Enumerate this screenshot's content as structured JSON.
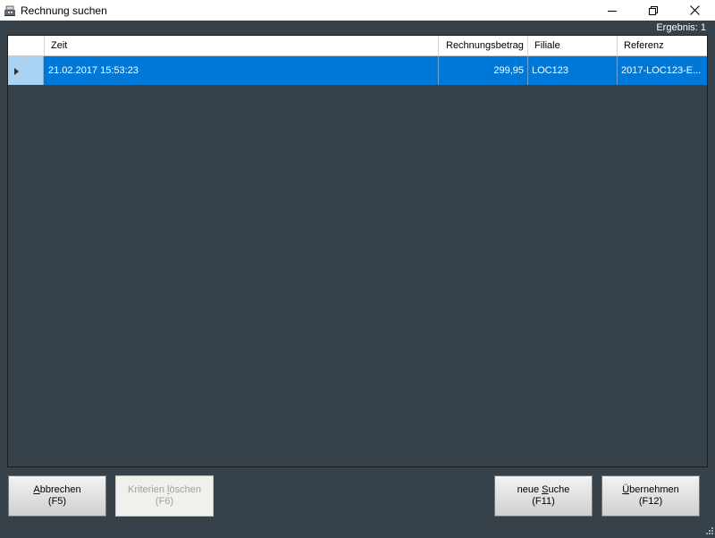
{
  "window": {
    "title": "Rechnung suchen",
    "icon": "cash-register-icon",
    "controls": [
      "minimize-icon",
      "restore-icon",
      "close-icon"
    ]
  },
  "result": {
    "label": "Ergebnis: 1"
  },
  "grid": {
    "columns": [
      "Zeit",
      "Rechnungsbetrag",
      "Filiale",
      "Referenz"
    ],
    "rows": [
      {
        "zeit": "21.02.2017 15:53:23",
        "betrag": "299,95",
        "filiale": "LOC123",
        "referenz": "2017-LOC123-E..."
      }
    ],
    "selected_row": 0
  },
  "buttons": {
    "cancel": {
      "pre": "",
      "accel": "A",
      "post": "bbrechen",
      "key": "(F5)"
    },
    "clear": {
      "pre": "Kriterien ",
      "accel": "l",
      "post": "öschen",
      "key": "(F6)",
      "enabled": false
    },
    "search": {
      "pre": "neue ",
      "accel": "S",
      "post": "uche",
      "key": "(F11)"
    },
    "accept": {
      "pre": "",
      "accel": "Ü",
      "post": "bernehmen",
      "key": "(F12)"
    }
  },
  "colors": {
    "background": "#36414a",
    "selection": "#0078d7",
    "row_header_selected": "#a9d2f3"
  }
}
